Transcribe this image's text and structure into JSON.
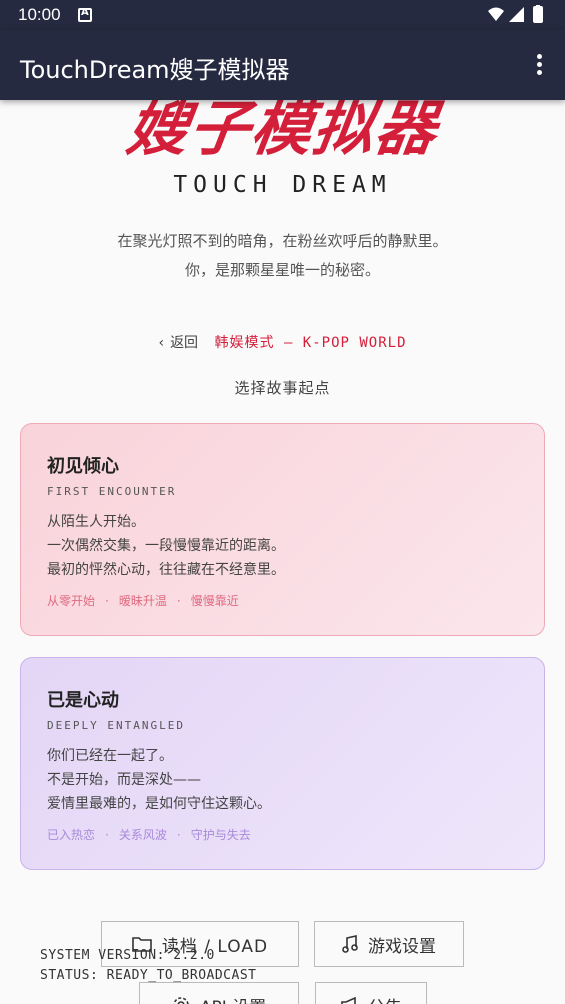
{
  "status_bar": {
    "time": "10:00"
  },
  "app_bar": {
    "title": "TouchDream嫂子模拟器"
  },
  "hero": {
    "title": "嫂子模拟器",
    "subtitle": "TOUCH DREAM",
    "tagline_1": "在聚光灯照不到的暗角，在粉丝欢呼后的静默里。",
    "tagline_2": "你，是那颗星星唯一的秘密。"
  },
  "nav": {
    "back_label": "返回",
    "mode_label": "韩娱模式 — K-POP WORLD"
  },
  "choose_label": "选择故事起点",
  "cards": [
    {
      "title": "初见倾心",
      "subtitle": "FIRST ENCOUNTER",
      "desc": [
        "从陌生人开始。",
        "一次偶然交集，一段慢慢靠近的距离。",
        "最初的怦然心动，往往藏在不经意里。"
      ],
      "tags": [
        "从零开始",
        "暧昧升温",
        "慢慢靠近"
      ]
    },
    {
      "title": "已是心动",
      "subtitle": "DEEPLY ENTANGLED",
      "desc": [
        "你们已经在一起了。",
        "不是开始，而是深处——",
        "爱情里最难的，是如何守住这颗心。"
      ],
      "tags": [
        "已入热恋",
        "关系风波",
        "守护与失去"
      ]
    }
  ],
  "footer": {
    "load_label": "读档 / LOAD",
    "settings_label": "游戏设置",
    "api_label": "API 设置",
    "notice_label": "公告"
  },
  "system": {
    "version_line": "SYSTEM VERSION: 2.2.0",
    "status_line": "STATUS: READY_TO_BROADCAST"
  },
  "icons": [
    "folder-icon",
    "music-note-icon",
    "gear-icon",
    "megaphone-icon",
    "wifi-icon",
    "signal-icon",
    "battery-icon",
    "chevron-left-icon",
    "overflow-menu-icon"
  ],
  "colors": {
    "accent": "#d41f3a",
    "app_bar": "#262a40"
  }
}
